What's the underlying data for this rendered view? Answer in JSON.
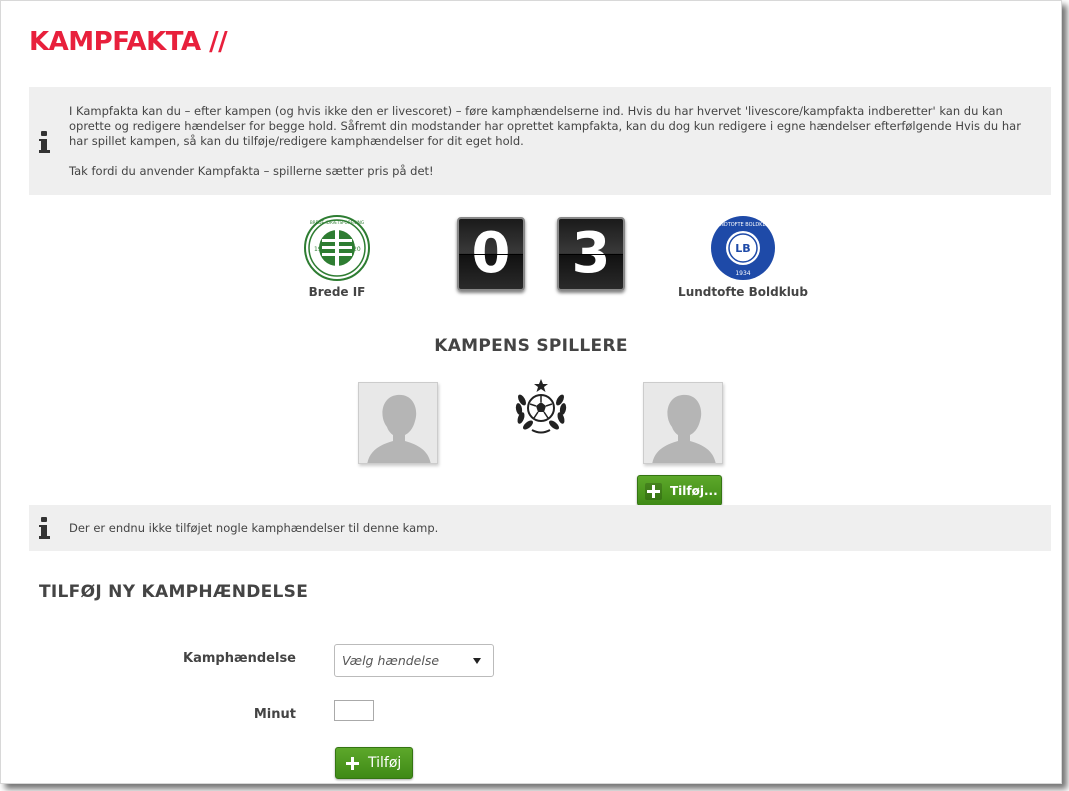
{
  "page": {
    "title": "KAMPFAKTA //"
  },
  "info_top": {
    "paragraph1": "I Kampfakta kan du – efter kampen (og hvis ikke den er livescoret) – føre kamphændelserne ind. Hvis du har hvervet 'livescore/kampfakta indberetter' kan du kan oprette og redigere hændelser for begge hold. Såfremt din modstander har oprettet kampfakta, kan du dog kun redigere i egne hændelser efterfølgende Hvis du har har spillet kampen, så kan du tilføje/redigere kamphændelser for dit eget hold.",
    "paragraph2": "Tak fordi du anvender Kampfakta – spillerne sætter pris på det!"
  },
  "match": {
    "home_team": "Brede IF",
    "away_team": "Lundtofte Boldklub",
    "home_score": "0",
    "away_score": "3",
    "home_logo_text": "BREDE IDRÆTSFORENING",
    "home_logo_year_left": "19",
    "home_logo_year_right": "20",
    "away_logo_text": "LUNDTOFTE BOLDKLUB",
    "away_logo_initials": "LB",
    "away_logo_year": "1934"
  },
  "players_section": {
    "title": "KAMPENS SPILLERE",
    "add_button_label": "Tilføj..."
  },
  "info_events": {
    "text": "Der er endnu ikke tilføjet nogle kamphændelser til denne kamp."
  },
  "add_event": {
    "title": "TILFØJ NY KAMPHÆNDELSE",
    "event_label": "Kamphændelse",
    "event_select_value": "Vælg hændelse",
    "minute_label": "Minut",
    "minute_value": "",
    "submit_label": "Tilføj"
  },
  "colors": {
    "accent_red": "#e8203c",
    "button_green": "#4c9a1f",
    "home_green": "#2e7d32",
    "away_blue": "#1e4aa8"
  },
  "icons": {
    "info": "info-icon",
    "avatar": "avatar-placeholder-icon",
    "mvp": "laurel-football-star-icon",
    "plus": "plus-icon",
    "dropdown": "caret-down-icon"
  }
}
